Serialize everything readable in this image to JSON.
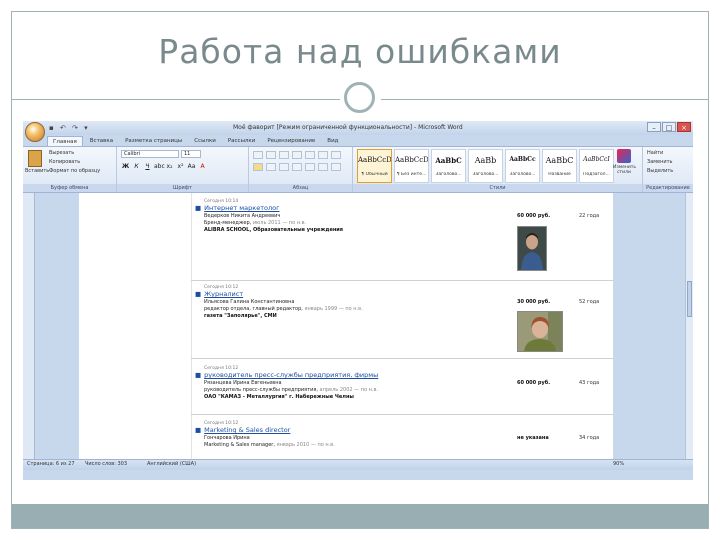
{
  "slide": {
    "title": "Работа над ошибками",
    "colors": {
      "accent": "#9fb3b6",
      "band": "#98aeb2",
      "title": "#7a8a8c"
    }
  },
  "word": {
    "window_title": "Моё фаворит [Режим ограниченной функциональности] - Microsoft Word",
    "tabs": [
      "Главная",
      "Вставка",
      "Разметка страницы",
      "Ссылки",
      "Рассылки",
      "Рецензирование",
      "Вид"
    ],
    "clipboard": {
      "paste": "Вставить",
      "cut": "Вырезать",
      "copy": "Копировать",
      "format_painter": "Формат по образцу",
      "group": "Буфер обмена"
    },
    "font": {
      "name": "Calibri",
      "size": "11",
      "group": "Шрифт"
    },
    "paragraph": {
      "group": "Абзац"
    },
    "styles": {
      "items": [
        {
          "sample": "AaBbCcD",
          "name": "¶ Обычный"
        },
        {
          "sample": "AaBbCcD",
          "name": "¶ Без инте..."
        },
        {
          "sample": "AaBbC",
          "name": "Заголово..."
        },
        {
          "sample": "AaBb",
          "name": "Заголово..."
        },
        {
          "sample": "AaBbCc",
          "name": "Заголово..."
        },
        {
          "sample": "AaBbC",
          "name": "Название"
        },
        {
          "sample": "AaBbCcI",
          "name": "Подзагол..."
        }
      ],
      "change": "Изменить стили",
      "group": "Стили"
    },
    "editing": {
      "find": "Найти",
      "replace": "Заменить",
      "select": "Выделить",
      "group": "Редактирование"
    },
    "status": {
      "page": "Страница: 6 из 27",
      "words": "Число слов: 303",
      "language": "Английский (США)",
      "zoom": "90%"
    }
  },
  "entries": [
    {
      "date": "Сегодня 10:14",
      "title": "Интернет маркетолог",
      "name": "Ведерков Никита Андреевич",
      "position": "Бренд-менеджер,",
      "period": "июль 2011 — по н.в.",
      "company": "ALIBRA SCHOOL, Образовательные учреждения",
      "salary": "60 000 руб.",
      "age": "22 года"
    },
    {
      "date": "Сегодня 10:12",
      "title": "Журналист",
      "name": "Ильясова Галина Константиновна",
      "position": "редактор отдела, главный редактор,",
      "period": "январь 1999 — по н.в.",
      "company": "газета \"Заполярье\", СМИ",
      "salary": "30 000 руб.",
      "age": "52 года"
    },
    {
      "date": "Сегодня 10:12",
      "title": "руководитель пресс-службы предприятия, фирмы",
      "name": "Рязанцева Ирина Евгеньевна",
      "position": "руководитель пресс-службы предприятия,",
      "period": "апрель 2002 — по н.в.",
      "company": "ОАО \"КАМАЗ - Металлургия\" г. Набережные Челны",
      "salary": "60 000 руб.",
      "age": "43 года"
    },
    {
      "date": "Сегодня 10:12",
      "title": "Marketing & Sales director",
      "name": "Гончарова Ирина",
      "position": "Marketing & Sales manager,",
      "period": "январь 2010 — по н.в.",
      "company": "",
      "salary": "не указана",
      "age": "34 года"
    }
  ]
}
